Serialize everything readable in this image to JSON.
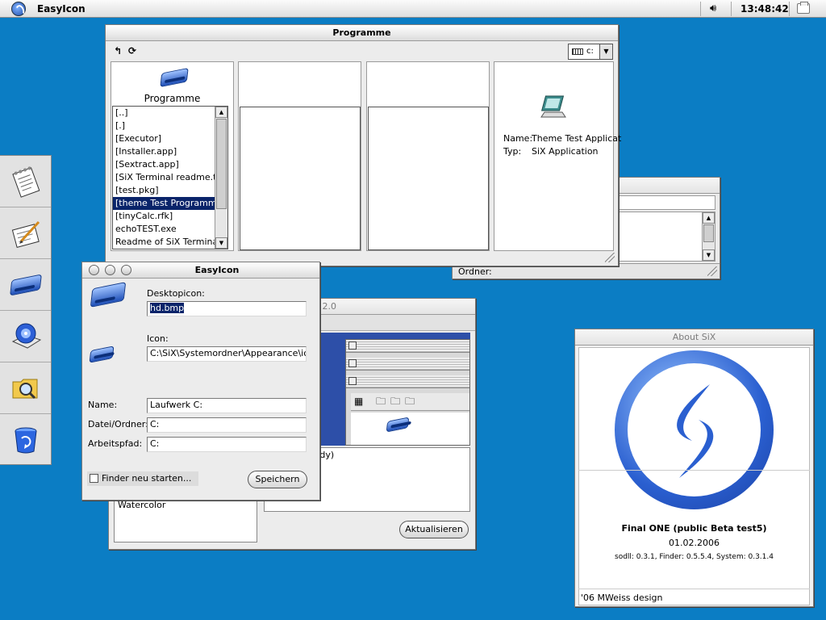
{
  "menubar": {
    "app_title": "EasyIcon",
    "clock": "13:48:42",
    "icons": [
      "six-logo-icon",
      "speaker-icon",
      "printer-icon"
    ]
  },
  "programme_window": {
    "title": "Programme",
    "toolbar_icons": [
      "parent-folder-icon",
      "refresh-icon"
    ],
    "drive": "c:",
    "folder_label": "Programme",
    "files": [
      "[..]",
      "[.]",
      "[Executor]",
      "[Installer.app]",
      "[Sextract.app]",
      "[SiX Terminal readme.txt.rfk]",
      "[test.pkg]",
      "[theme Test Programm.app]",
      "[tinyCalc.rfk]",
      "echoTEST.exe",
      "Readme of SiX Terminal.txt"
    ],
    "selected_index": 7,
    "info": {
      "name_label": "Name:",
      "name_value": "Theme Test Applicat",
      "type_label": "Typ:",
      "type_value": "SiX Application"
    }
  },
  "small_window": {
    "folder_label": "Ordner:"
  },
  "theme_window": {
    "title_fragment": "l 2.0",
    "theme_item": "ver (Rhapsody)",
    "list_item": "Watercolor",
    "refresh_button": "Aktualisieren"
  },
  "easyicon_dialog": {
    "title": "EasyIcon",
    "desktopicon_label": "Desktopicon:",
    "desktopicon_value": "hd.bmp",
    "icon_label": "Icon:",
    "icon_value": "C:\\SiX\\Systemordner\\Appearance\\icons\\",
    "name_label": "Name:",
    "name_value": "Laufwerk C:",
    "path_label": "Datei/Ordner:",
    "path_value": "C:",
    "workdir_label": "Arbeitspfad:",
    "workdir_value": "C:",
    "restart_finder_label": "Finder neu starten...",
    "restart_finder_checked": false,
    "save_button": "Speichern"
  },
  "about_window": {
    "title": "About SiX",
    "version": "Final ONE (public Beta test5)",
    "date": "01.02.2006",
    "components": "sodll: 0.3.1, Finder: 0.5.5.4, System: 0.3.1.4",
    "credit": "'06 MWeiss design"
  },
  "dock": {
    "items": [
      "notepad-icon",
      "text-editor-icon",
      "hard-drive-icon",
      "cd-drive-icon",
      "search-folder-icon",
      "recycle-bin-icon"
    ]
  },
  "colors": {
    "desktop": "#0b7dc4",
    "selection": "#0a246a",
    "window": "#ececec"
  }
}
